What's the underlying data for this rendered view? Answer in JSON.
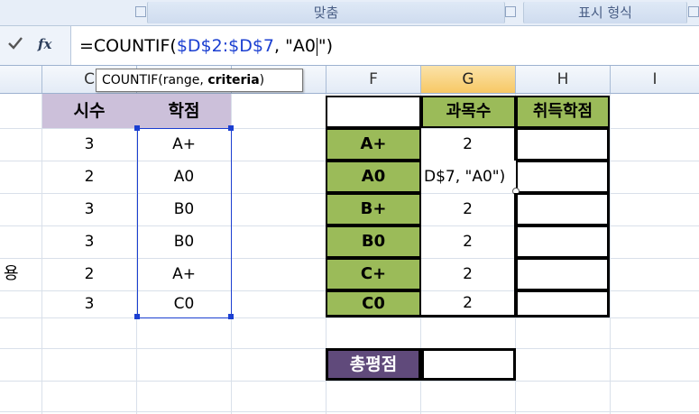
{
  "ribbon": {
    "groups": [
      {
        "label": "맞춤"
      },
      {
        "label": "표시 형식"
      }
    ]
  },
  "formula_bar": {
    "confirm_icon": "checkmark-icon",
    "fx_label": "fx",
    "formula_prefix": "=COUNTIF(",
    "formula_ref": "$D$2:$D$7",
    "formula_suffix_a": ", \"A0",
    "formula_suffix_b": "\")"
  },
  "tooltip": {
    "text_plain": "COUNTIF(range, ",
    "text_bold": "criteria",
    "text_end": ")"
  },
  "columns": {
    "c": "C",
    "f": "F",
    "g": "G",
    "h": "H",
    "i": "I"
  },
  "left_table": {
    "headers": [
      "시수",
      "학점"
    ],
    "rows": [
      [
        "3",
        "A+"
      ],
      [
        "2",
        "A0"
      ],
      [
        "3",
        "B0"
      ],
      [
        "3",
        "B0"
      ],
      [
        "2",
        "A+"
      ],
      [
        "3",
        "C0"
      ]
    ],
    "side_label": "용"
  },
  "right_table": {
    "headers": [
      "과목수",
      "취득학점"
    ],
    "rows": [
      {
        "grade": "A+",
        "count": "2",
        "credit": ""
      },
      {
        "grade": "A0",
        "count": "D$7, \"A0\")",
        "credit": ""
      },
      {
        "grade": "B+",
        "count": "2",
        "credit": ""
      },
      {
        "grade": "B0",
        "count": "2",
        "credit": ""
      },
      {
        "grade": "C+",
        "count": "2",
        "credit": ""
      },
      {
        "grade": "C0",
        "count": "2",
        "credit": ""
      }
    ],
    "total_label": "총평점",
    "total_value": ""
  },
  "colors": {
    "header_purple": "#ccc0da",
    "grade_green": "#9bbb59",
    "total_purple": "#604a7b",
    "selection_blue": "#1b3fd1"
  }
}
